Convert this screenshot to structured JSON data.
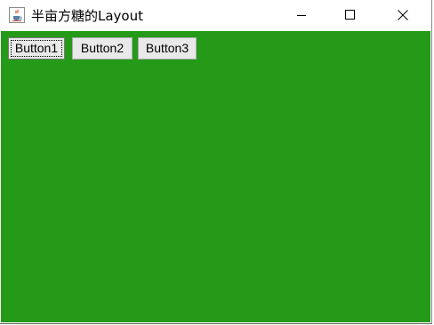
{
  "window": {
    "title": "半亩方糖的Layout",
    "app_icon": "java-coffee-cup-icon",
    "controls": [
      "minimize-icon",
      "maximize-icon",
      "close-icon"
    ]
  },
  "content": {
    "background_color": "#259a19",
    "buttons": [
      {
        "label": "Button1",
        "focused": true
      },
      {
        "label": "Button2",
        "focused": false
      },
      {
        "label": "Button3",
        "focused": false
      }
    ]
  }
}
